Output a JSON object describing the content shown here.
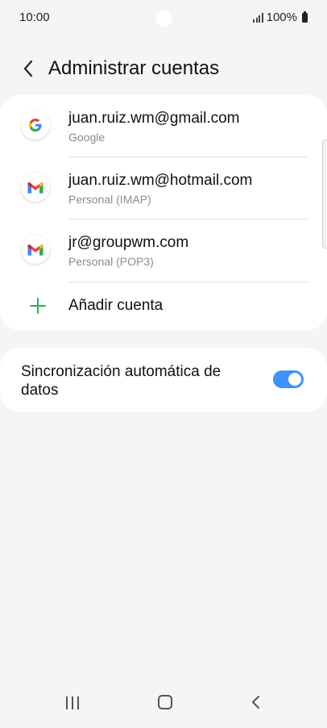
{
  "status_bar": {
    "time": "10:00",
    "battery": "100%"
  },
  "header": {
    "title": "Administrar cuentas"
  },
  "accounts": [
    {
      "title": "juan.ruiz.wm@gmail.com",
      "subtitle": "Google",
      "icon": "google-icon"
    },
    {
      "title": "juan.ruiz.wm@hotmail.com",
      "subtitle": "Personal (IMAP)",
      "icon": "gmail-icon"
    },
    {
      "title": "jr@groupwm.com",
      "subtitle": "Personal (POP3)",
      "icon": "gmail-icon"
    }
  ],
  "add_account": {
    "label": "Añadir cuenta",
    "icon": "plus-icon"
  },
  "sync": {
    "label": "Sincronización automática de datos",
    "enabled": true
  },
  "colors": {
    "accent": "#3e91ff",
    "add_green": "#2db34a"
  }
}
